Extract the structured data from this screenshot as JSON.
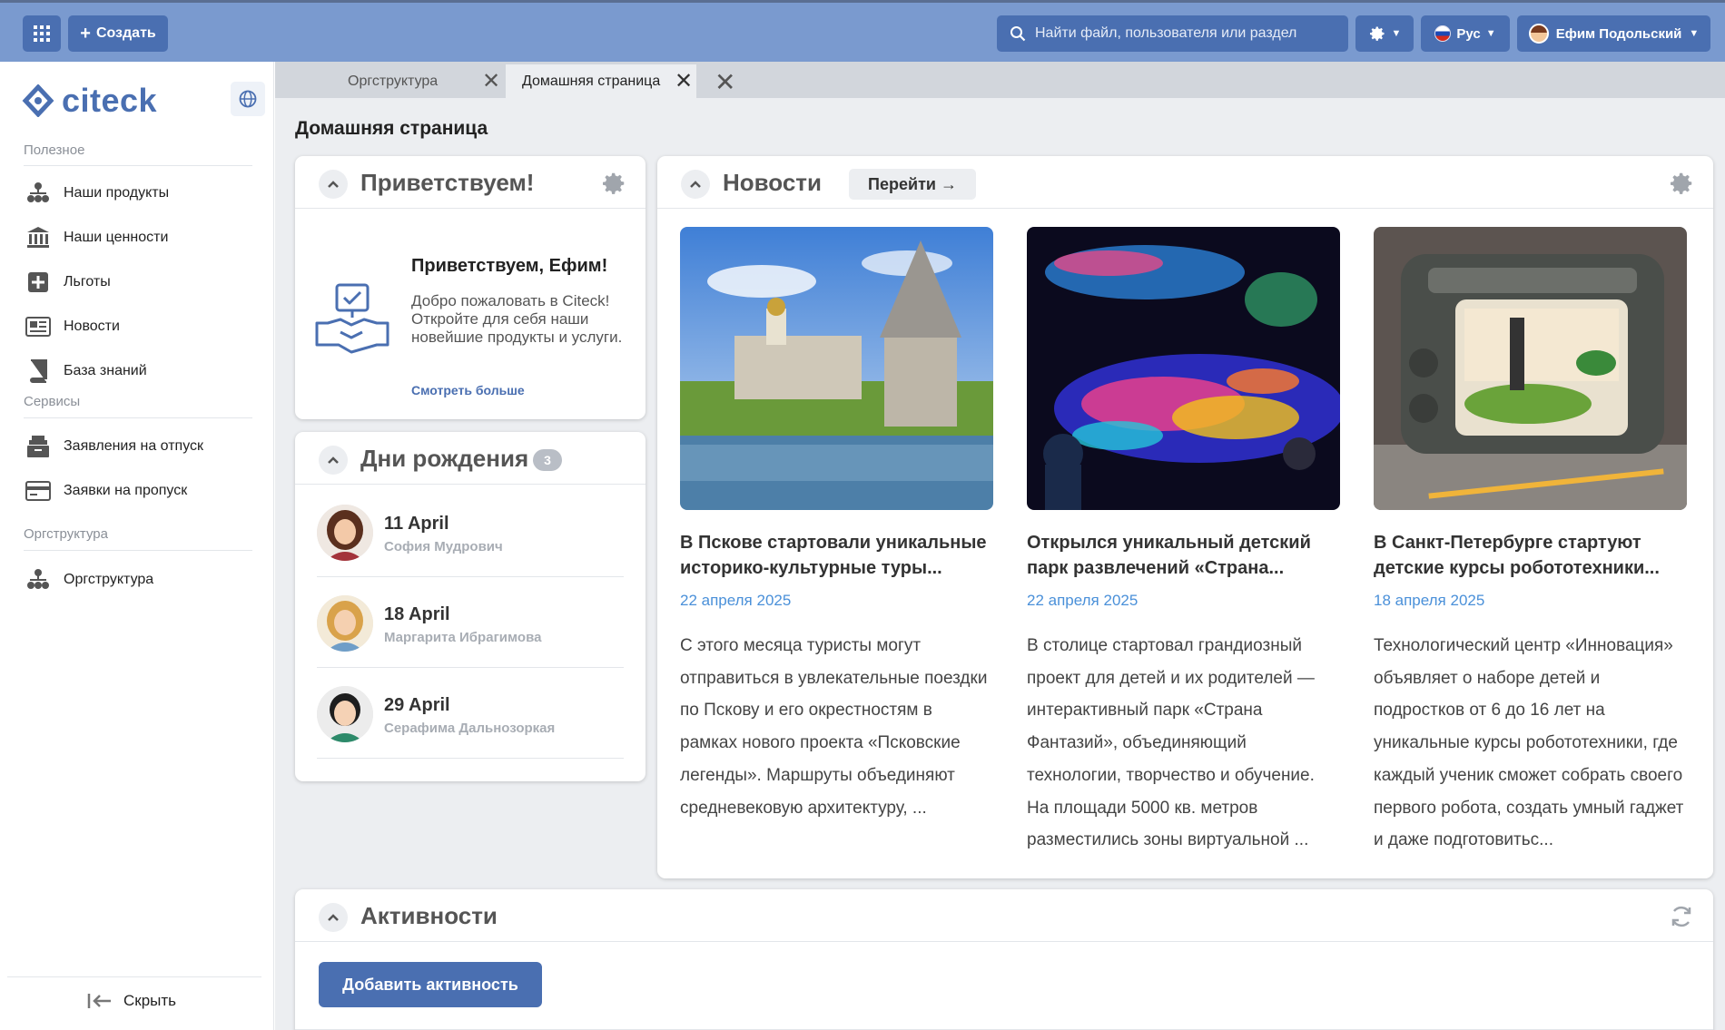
{
  "topbar": {
    "create_label": "Создать",
    "search_placeholder": "Найти файл, пользователя или раздел",
    "lang_label": "Рус",
    "user_name": "Ефим Подольский"
  },
  "sidebar": {
    "logo_text": "citeck",
    "sections": [
      {
        "label": "Полезное"
      },
      {
        "label": "Сервисы"
      },
      {
        "label": "Оргструктура"
      }
    ],
    "items": [
      {
        "label": "Наши продукты",
        "icon": "org-tree-icon"
      },
      {
        "label": "Наши ценности",
        "icon": "bank-icon"
      },
      {
        "label": "Льготы",
        "icon": "plus-square-icon"
      },
      {
        "label": "Новости",
        "icon": "newspaper-icon"
      },
      {
        "label": "База знаний",
        "icon": "book-icon"
      },
      {
        "label": "Заявления на отпуск",
        "icon": "archive-box-icon"
      },
      {
        "label": "Заявки на пропуск",
        "icon": "card-icon"
      },
      {
        "label": "Оргструктура",
        "icon": "org-tree-icon"
      }
    ],
    "hide_label": "Скрыть"
  },
  "tabs": [
    {
      "label": "Оргструктура",
      "active": false
    },
    {
      "label": "Домашняя страница",
      "active": true
    }
  ],
  "page_title": "Домашняя страница",
  "welcome": {
    "title": "Приветствуем!",
    "heading": "Приветствуем, Ефим!",
    "text": "Добро пожаловать в Citeck! Откройте для себя наши новейшие продукты и услуги.",
    "link": "Смотреть больше"
  },
  "birthdays": {
    "title": "Дни рождения",
    "count": "3",
    "items": [
      {
        "date": "11 April",
        "name": "София Мудрович"
      },
      {
        "date": "18 April",
        "name": "Маргарита Ибрагимова"
      },
      {
        "date": "29 April",
        "name": "Серафима Дальнозоркая"
      }
    ]
  },
  "news": {
    "title": "Новости",
    "goto_label": "Перейти →",
    "items": [
      {
        "title": "В Пскове стартовали уникальные историко-культурные туры...",
        "date": "22 апреля 2025",
        "text": "С этого месяца туристы могут отправиться в увлекательные поездки по Пскову и его окрестностям в рамках нового проекта «Псковские легенды». Маршруты объединяют средневековую архитектуру, ..."
      },
      {
        "title": "Открылся уникальный детский парк развлечений «Страна...",
        "date": "22 апреля 2025",
        "text": "В столице стартовал грандиозный проект для детей и их родителей — интерактивный парк «Страна Фантазий», объединяющий технологии, творчество и обучение. На площади 5000 кв. метров разместились зоны виртуальной ..."
      },
      {
        "title": "В Санкт-Петербурге стартуют детские курсы робототехники...",
        "date": "18 апреля 2025",
        "text": "Технологический центр «Инновация» объявляет о наборе детей и подростков от 6 до 16 лет на уникальные курсы робототехники, где каждый ученик сможет собрать своего первого робота, создать умный гаджет и даже подготовитьс..."
      }
    ]
  },
  "activities": {
    "title": "Активности",
    "add_label": "Добавить активность"
  },
  "colors": {
    "accent": "#4a6fb1",
    "topbar": "#7a9acf",
    "date_link": "#4a90d9"
  }
}
